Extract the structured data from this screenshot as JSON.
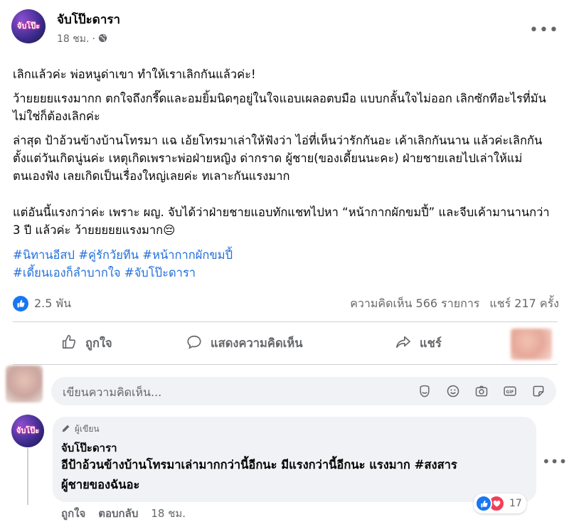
{
  "post": {
    "page_name": "จับโป๊ะดารา",
    "avatar_text": "จับโป๊ะ",
    "time": "18 ชม.",
    "audience_icon": "globe-icon",
    "paragraphs": [
      "เลิกแล้วค่ะ พ่อหนูด่าเขา ทำให้เราเลิกกันแล้วค่ะ!",
      "ว้ายยยยแรงมากก ตกใจถึงกรี๊ดและอมยิ้มนิดๆอยู่ในใจแอบเผลอตบมือ แบบกลั้นใจไม่ออก เลิกซักทีอะไรที่มันไม่ใช่ก็ต้องเลิกค่ะ",
      "ล่าสุด ป้าอ้วนข้างบ้านโทรมา แฉ เอ้ยโทรมาเล่าให้ฟังว่า ไอ่ที่เห็นว่ารักกันอะ เค้าเลิกกันนาน แล้วค่ะเลิกกันตั้งแต่วันเกิดนู่นค่ะ เหตุเกิดเพราะพ่อฝ่ายหญิง ด่ากราด ผู้ชาย(ของเดี้ยนนะคะ) ฝ่ายชายเลยไปเล่าให้แม่ตนเองฟัง เลยเกิดเป็นเรื่องใหญ่เลยค่ะ ทเลาะกันแรงมาก",
      "แต่อันนี้แรงกว่าค่ะ เพราะ ผญ. จับได้ว่าฝ่ายชายแอบทักแชทไปหา “หน้ากากผักขมปี้” และจีบเค้ามานานกว่า 3 ปี แล้วค่ะ ว้ายยยยยแรงมาก😔"
    ],
    "hashtags_line1": "#นิทานอีสป #คู่รักวัยทีน #หน้ากากผักขมปี้",
    "hashtags_line2": "#เดี้ยนเองก็ลำบากใจ #จับโป๊ะดารา"
  },
  "stats": {
    "reactions": "2.5 พัน",
    "comments": "ความคิดเห็น 566 รายการ",
    "shares": "แชร์ 217 ครั้ง"
  },
  "actions": {
    "like": "ถูกใจ",
    "comment": "แสดงความคิดเห็น",
    "share": "แชร์"
  },
  "composer": {
    "placeholder": "เขียนความคิดเห็น..."
  },
  "comment": {
    "badge": "ผู้เขียน",
    "author": "จับโป๊ะดารา",
    "avatar_text": "จับโป๊ะ",
    "line1": "อีป้าอ้วนข้างบ้านโทรมาเล่ามากกว่านี้อีกนะ มีแรงกว่านี้อีกนะ แรงมาก #สงสาร",
    "line2": "ผู้ชายของฉันอะ",
    "reaction_count": "17",
    "like": "ถูกใจ",
    "reply": "ตอบกลับ",
    "time": "18 ชม."
  },
  "colors": {
    "accent": "#1877f2",
    "hashtag": "#216fdb",
    "secondary_text": "#65676b",
    "love": "#f33e58"
  }
}
